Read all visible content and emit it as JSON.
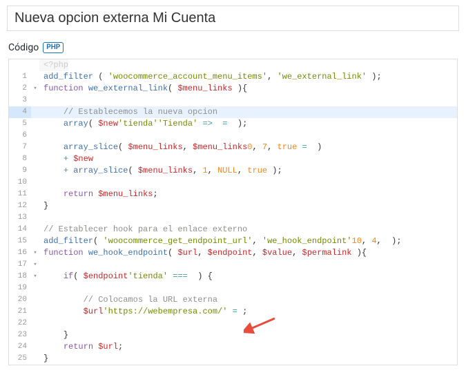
{
  "title_value": "Nueva opcion externa Mi Cuenta",
  "section_label": "Código",
  "php_badge": "PHP",
  "php_open_tag": "<?php",
  "lines": [
    {
      "n": 1,
      "fold": "",
      "hl": false
    },
    {
      "n": 2,
      "fold": "▾",
      "hl": false
    },
    {
      "n": 3,
      "fold": "",
      "hl": false
    },
    {
      "n": 4,
      "fold": "",
      "hl": true
    },
    {
      "n": 5,
      "fold": "",
      "hl": false
    },
    {
      "n": 6,
      "fold": "",
      "hl": false
    },
    {
      "n": 7,
      "fold": "",
      "hl": false
    },
    {
      "n": 8,
      "fold": "",
      "hl": false
    },
    {
      "n": 9,
      "fold": "",
      "hl": false
    },
    {
      "n": 10,
      "fold": "",
      "hl": false
    },
    {
      "n": 11,
      "fold": "",
      "hl": false
    },
    {
      "n": 12,
      "fold": "",
      "hl": false
    },
    {
      "n": 13,
      "fold": "",
      "hl": false
    },
    {
      "n": 14,
      "fold": "",
      "hl": false
    },
    {
      "n": 15,
      "fold": "",
      "hl": false
    },
    {
      "n": 16,
      "fold": "▾",
      "hl": false
    },
    {
      "n": 17,
      "fold": "▾",
      "hl": false
    },
    {
      "n": 18,
      "fold": "▾",
      "hl": false
    },
    {
      "n": 19,
      "fold": "",
      "hl": false
    },
    {
      "n": 20,
      "fold": "",
      "hl": false
    },
    {
      "n": 21,
      "fold": "",
      "hl": false
    },
    {
      "n": 22,
      "fold": "",
      "hl": false
    },
    {
      "n": 23,
      "fold": "",
      "hl": false
    },
    {
      "n": 24,
      "fold": "",
      "hl": false
    },
    {
      "n": 25,
      "fold": "",
      "hl": false
    }
  ],
  "code": {
    "l1": {
      "fn": "add_filter",
      "p1": " ( ",
      "s1": "'woocommerce_account_menu_items'",
      "c1": ", ",
      "s2": "'we_external_link'",
      "p2": " );"
    },
    "l2": {
      "kw": "function",
      "sp": " ",
      "fn": "we_external_link",
      "p1": "( ",
      "v": "$menu_links",
      "p2": " ){"
    },
    "l4": {
      "ind": "    ",
      "cm": "// Establecemos la nueva opcion"
    },
    "l5": {
      "ind": "    ",
      "v": "$new",
      "eq": " = ",
      "fn": "array",
      "p1": "( ",
      "s1": "'tienda'",
      "arr": " => ",
      "s2": "'Tienda'",
      "p2": " );"
    },
    "l7": {
      "ind": "    ",
      "v": "$menu_links",
      "eq": " = ",
      "fn": "array_slice",
      "p1": "( ",
      "v2": "$menu_links",
      "c1": ", ",
      "n1": "0",
      "c2": ", ",
      "n2": "7",
      "c3": ", ",
      "b": "true",
      "p2": " )"
    },
    "l8": {
      "ind": "    ",
      "plus": "+ ",
      "v": "$new"
    },
    "l9": {
      "ind": "    ",
      "plus": "+ ",
      "fn": "array_slice",
      "p1": "( ",
      "v": "$menu_links",
      "c1": ", ",
      "n1": "1",
      "c2": ", ",
      "null": "NULL",
      "c3": ", ",
      "b": "true",
      "p2": " );"
    },
    "l11": {
      "ind": "    ",
      "kw": "return",
      "sp": " ",
      "v": "$menu_links",
      "sc": ";"
    },
    "l12": {
      "br": "}"
    },
    "l14": {
      "cm": "// Establecer hook para el enlace externo"
    },
    "l15": {
      "fn": "add_filter",
      "p1": "( ",
      "s1": "'woocommerce_get_endpoint_url'",
      "c1": ", ",
      "s2": "'we_hook_endpoint'",
      "c2": ", ",
      "n1": "10",
      "c3": ", ",
      "n2": "4",
      "p2": " );"
    },
    "l16": {
      "kw": "function",
      "sp": " ",
      "fn": "we_hook_endpoint",
      "p1": "( ",
      "v1": "$url",
      "c1": ", ",
      "v2": "$endpoint",
      "c2": ", ",
      "v3": "$value",
      "c3": ", ",
      "v4": "$permalink",
      "p2": " ){"
    },
    "l18": {
      "ind": "    ",
      "kw": "if",
      "p1": "( ",
      "s1": "'tienda'",
      "eq": " === ",
      "v": "$endpoint",
      "p2": " ) {"
    },
    "l20": {
      "ind": "        ",
      "cm": "// Colocamos la URL externa"
    },
    "l21": {
      "ind": "        ",
      "v": "$url",
      "eq": " = ",
      "s1": "'https://webempresa.com/'",
      "sc": ";"
    },
    "l23": {
      "ind": "    ",
      "br": "}"
    },
    "l24": {
      "ind": "    ",
      "kw": "return",
      "sp": " ",
      "v": "$url",
      "sc": ";"
    },
    "l25": {
      "br": "}"
    }
  }
}
